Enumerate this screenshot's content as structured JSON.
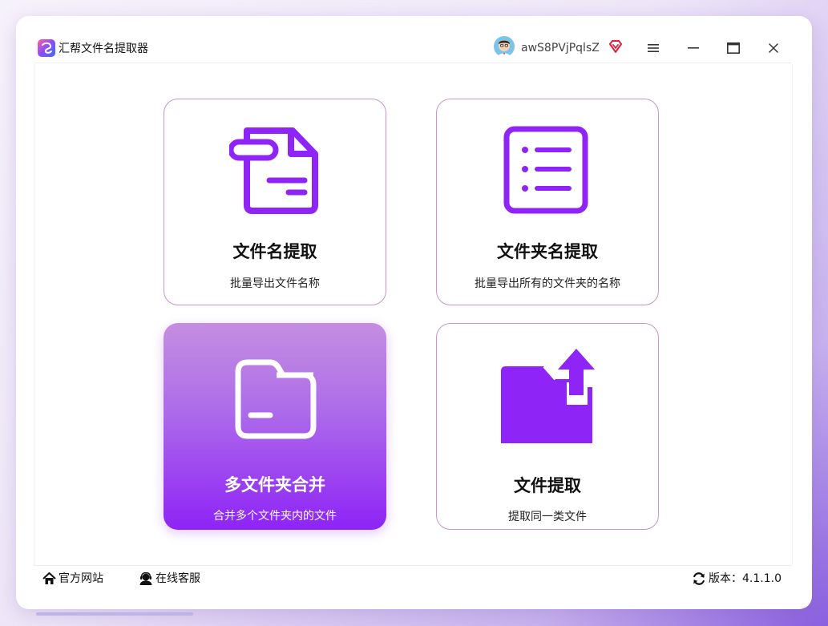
{
  "window": {
    "title": "汇帮文件名提取器",
    "username": "awS8PVjPqlsZ"
  },
  "cards": [
    {
      "title": "文件名提取",
      "desc": "批量导出文件名称",
      "icon": "file-icon"
    },
    {
      "title": "文件夹名提取",
      "desc": "批量导出所有的文件夹的名称",
      "icon": "list-document-icon"
    },
    {
      "title": "多文件夹合并",
      "desc": "合并多个文件夹内的文件",
      "icon": "folder-icon"
    },
    {
      "title": "文件提取",
      "desc": "提取同一类文件",
      "icon": "folder-upload-icon"
    }
  ],
  "footer": {
    "website": "官方网站",
    "service": "在线客服",
    "version_label": "版本：",
    "version": "4.1.1.0"
  },
  "colors": {
    "accent": "#8e24f6",
    "card_border": "#c993cf",
    "vip": "#e0213b"
  }
}
